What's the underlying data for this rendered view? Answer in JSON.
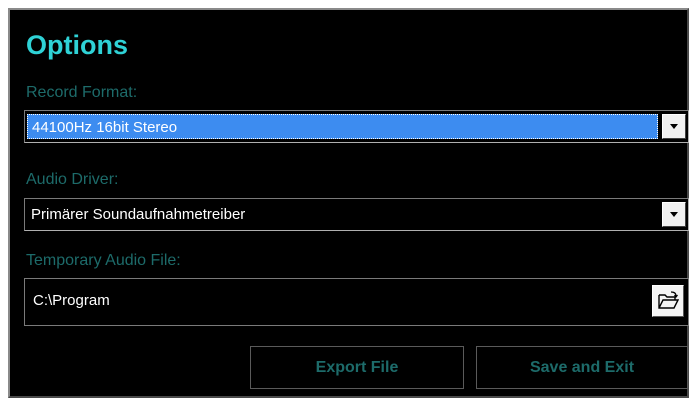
{
  "dialog": {
    "title": "Options",
    "record_format": {
      "label": "Record Format:",
      "value": "44100Hz 16bit Stereo"
    },
    "audio_driver": {
      "label": "Audio Driver:",
      "value": "Primärer Soundaufnahmetreiber"
    },
    "temp_file": {
      "label": "Temporary Audio File:",
      "value": "C:\\Program"
    },
    "buttons": {
      "export": "Export File",
      "save_exit": "Save and Exit"
    }
  },
  "colors": {
    "background": "#000000",
    "title": "#2fd2d6",
    "label": "#1d6b6a",
    "selection": "#3d8cf0"
  },
  "icons": {
    "dropdown": "chevron-down-icon",
    "browse": "open-folder-icon"
  }
}
